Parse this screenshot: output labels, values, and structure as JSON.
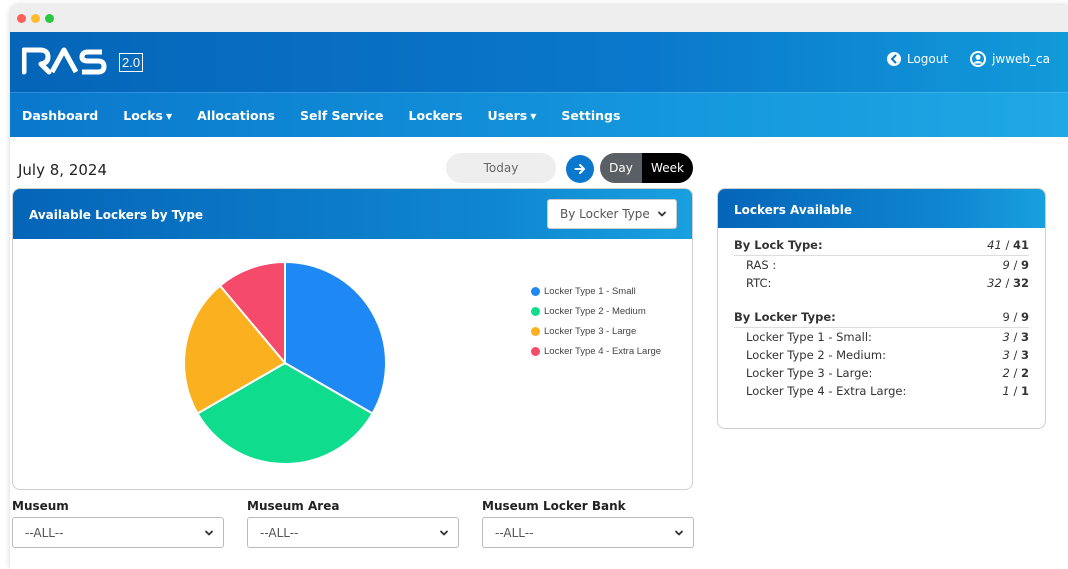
{
  "app": {
    "logo_text": "RAS",
    "version": "2.0"
  },
  "header": {
    "logout_label": "Logout",
    "user_label": "jwweb_ca"
  },
  "nav": {
    "items": [
      {
        "label": "Dashboard",
        "dropdown": false
      },
      {
        "label": "Locks",
        "dropdown": true
      },
      {
        "label": "Allocations",
        "dropdown": false
      },
      {
        "label": "Self Service",
        "dropdown": false
      },
      {
        "label": "Lockers",
        "dropdown": false
      },
      {
        "label": "Users",
        "dropdown": true
      },
      {
        "label": "Settings",
        "dropdown": false
      }
    ]
  },
  "toolbar": {
    "date": "July 8, 2024",
    "today_label": "Today",
    "day_label": "Day",
    "week_label": "Week"
  },
  "chart_card": {
    "title": "Available Lockers by Type",
    "select_value": "By Locker Type"
  },
  "chart_data": {
    "type": "pie",
    "categories": [
      "Locker Type 1 - Small",
      "Locker Type 2 - Medium",
      "Locker Type 3 - Large",
      "Locker Type 4 - Extra Large"
    ],
    "values": [
      3,
      3,
      2,
      1
    ],
    "colors": [
      "#1e88f5",
      "#0fdc8c",
      "#fbb020",
      "#f54a6a"
    ],
    "legend": "right"
  },
  "lockers_card": {
    "title": "Lockers Available",
    "lock_type": {
      "label": "By Lock Type:",
      "available": "41",
      "total": "41",
      "rows": [
        {
          "label": "RAS :",
          "available": "9",
          "total": "9"
        },
        {
          "label": "RTC:",
          "available": "32",
          "total": "32"
        }
      ]
    },
    "locker_type": {
      "label": "By Locker Type:",
      "available": "9",
      "total": "9",
      "rows": [
        {
          "label": "Locker Type 1 - Small:",
          "available": "3",
          "total": "3"
        },
        {
          "label": "Locker Type 2 - Medium:",
          "available": "3",
          "total": "3"
        },
        {
          "label": "Locker Type 3 - Large:",
          "available": "2",
          "total": "2"
        },
        {
          "label": "Locker Type 4 - Extra Large:",
          "available": "1",
          "total": "1"
        }
      ]
    }
  },
  "filters": {
    "museum": {
      "label": "Museum",
      "value": "--ALL--"
    },
    "area": {
      "label": "Museum Area",
      "value": "--ALL--"
    },
    "bank": {
      "label": "Museum Locker Bank",
      "value": "--ALL--"
    }
  }
}
